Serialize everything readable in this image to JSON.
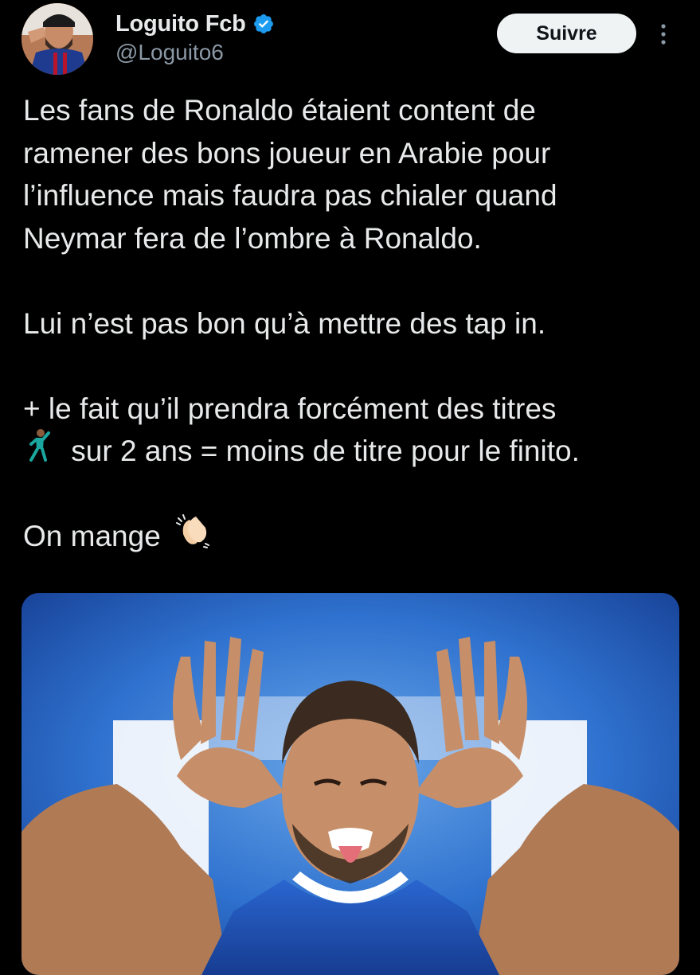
{
  "author": {
    "display_name": "Loguito Fcb",
    "handle": "@Loguito6",
    "verified": true,
    "verified_color": "#1d9bf0"
  },
  "actions": {
    "follow_label": "Suivre",
    "more_icon": "more-vertical-icon"
  },
  "tweet": {
    "paragraphs": [
      [
        "Les fans de Ronaldo étaient content de",
        "ramener des bons joueur en Arabie pour",
        "l’influence mais faudra pas chialer quand",
        "Neymar fera de l’ombre à Ronaldo."
      ],
      [
        "Lui n’est pas bon qu’à mettre des tap in."
      ],
      [
        "+ le fait qu’il prendra forcément des titres",
        "sur 2 ans = moins de titre pour le finito."
      ],
      [
        "On mange"
      ]
    ],
    "emoji_dancer": "dancing-man-icon",
    "emoji_clap": "clapping-hands-icon"
  },
  "media": {
    "kind": "photo",
    "accent_color": "#1f6fd0"
  },
  "colors": {
    "background": "#000000",
    "text": "#e7e9ea",
    "secondary_text": "#8b98a5",
    "button_bg": "#eff3f4",
    "button_text": "#0f1419"
  }
}
